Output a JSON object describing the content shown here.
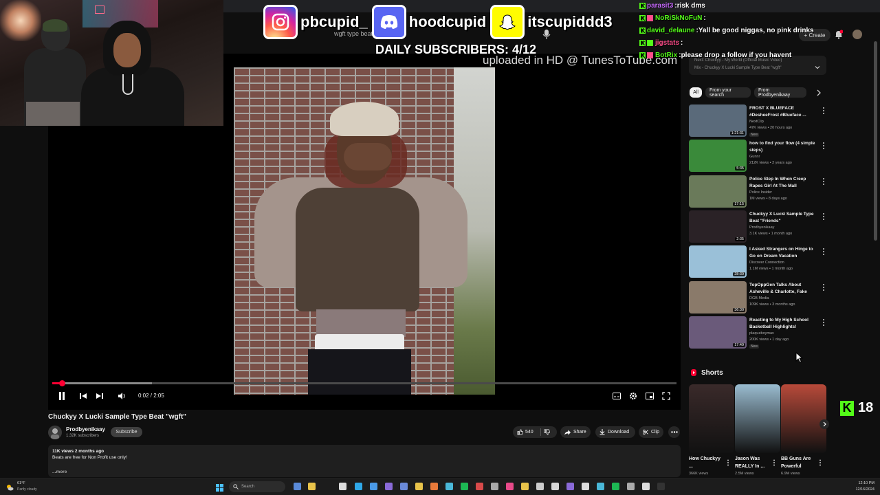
{
  "overlay": {
    "social": [
      {
        "platform": "instagram-icon",
        "handle": "pbcupid_"
      },
      {
        "platform": "discord-icon",
        "handle": "hoodcupid"
      },
      {
        "platform": "snapchat-icon",
        "handle": "itscupiddd3"
      }
    ],
    "daily_subscribers": "DAILY SUBSCRIBERS: 4/12",
    "uploaded_hd": "uploaded in HD @ TunesToTube.com",
    "kick_viewers": "18"
  },
  "chat": [
    {
      "user": "parasit3",
      "user_color": "#c86bff",
      "msg": "risk dms"
    },
    {
      "user": "NoRiSkNoFuN",
      "user_color": "#53fc18",
      "msg": ""
    },
    {
      "user": "david_delaune",
      "user_color": "#53fc18",
      "msg": "Yall be good niggas, no pink drinks"
    },
    {
      "user": "jigstats",
      "user_color": "#ff4d8a",
      "msg": ""
    },
    {
      "user": "BotRix",
      "user_color": "#53fc18",
      "msg": "please drop a follow if you havent"
    }
  ],
  "youtube_header": {
    "search_value": "wgft type beat",
    "create_label": "+ Create"
  },
  "player": {
    "current_time": "0:02",
    "duration": "2:05",
    "time_text": "0:02 / 2:05",
    "played_fraction": 0.016,
    "buffered_fraction": 0.16
  },
  "video": {
    "title": "Chuckyy X Lucki Sample Type Beat \"wgft\"",
    "channel": "Prodbyenikaay",
    "subscribers": "1.32K subscribers",
    "subscribe_label": "Subscribe",
    "likes": "540",
    "share_label": "Share",
    "download_label": "Download",
    "clip_label": "Clip",
    "stats": "11K views  2 months ago",
    "description": "Beats are free for Non Profit use only!",
    "more_label": "...more"
  },
  "sidebar": {
    "mix_line1": "Next: Chuckyy - My World (Official Music Video)",
    "mix_line2": "Mix - Chuckyy X Lucki Sample Type Beat \"wgft\"",
    "chips": [
      "All",
      "From your search",
      "From Prodbyenikaay"
    ],
    "recommendations": [
      {
        "title": "FROST X BLUEFACE #DesheeFrost #Blueface ...",
        "channel": "NextClip",
        "meta": "47K views • 20 hours ago",
        "duration": "1:21:31",
        "badge": "New",
        "thumb": "#5a6a7a"
      },
      {
        "title": "how to find your flow (4 simple steps)",
        "channel": "Gunnr",
        "meta": "212K views • 2 years ago",
        "duration": "5:35",
        "badge": "",
        "thumb": "#3a8a3a"
      },
      {
        "title": "Police Step In When Creep Rapes Girl At The Mall",
        "channel": "Police Insider",
        "meta": "1M views • 8 days ago",
        "duration": "17:15",
        "badge": "",
        "thumb": "#6a7a5a"
      },
      {
        "title": "Chuckyy X Lucki Sample Type Beat \"Friends\"",
        "channel": "Prodbyenikaay",
        "meta": "3.1K views • 1 month ago",
        "duration": "2:35",
        "badge": "",
        "thumb": "#2a2226"
      },
      {
        "title": "I Asked Strangers on Hinge to Go on Dream Vacation",
        "channel": "Discover Connection",
        "meta": "1.1M views • 1 month ago",
        "duration": "28:39",
        "badge": "",
        "thumb": "#9ac0d8"
      },
      {
        "title": "TopOppGen Talks About Asheville & Charlotte, Fake Pill...",
        "channel": "DGB Media",
        "meta": "109K views • 3 months ago",
        "duration": "36:30",
        "badge": "",
        "thumb": "#8a7a6a"
      },
      {
        "title": "Reacting to My High School Basketball Highlights!",
        "channel": "plaqueboymax",
        "meta": "200K views • 1 day ago",
        "duration": "17:49",
        "badge": "New",
        "thumb": "#6a5a7a"
      }
    ],
    "shorts_heading": "Shorts",
    "shorts": [
      {
        "title": "How Chuckyy ...",
        "views": "366K views",
        "thumb": "#3a2a2a"
      },
      {
        "title": "Jason Was REALLY In ...",
        "views": "2.5M views",
        "thumb": "#9abcd0"
      },
      {
        "title": "BB Guns Are Powerful",
        "views": "6.9M views",
        "thumb": "#b84a3a"
      }
    ]
  },
  "taskbar": {
    "weather_temp": "61°F",
    "weather_desc": "Partly cloudy",
    "search_placeholder": "Search",
    "time": "12:10 PM",
    "date": "12/16/2024"
  }
}
